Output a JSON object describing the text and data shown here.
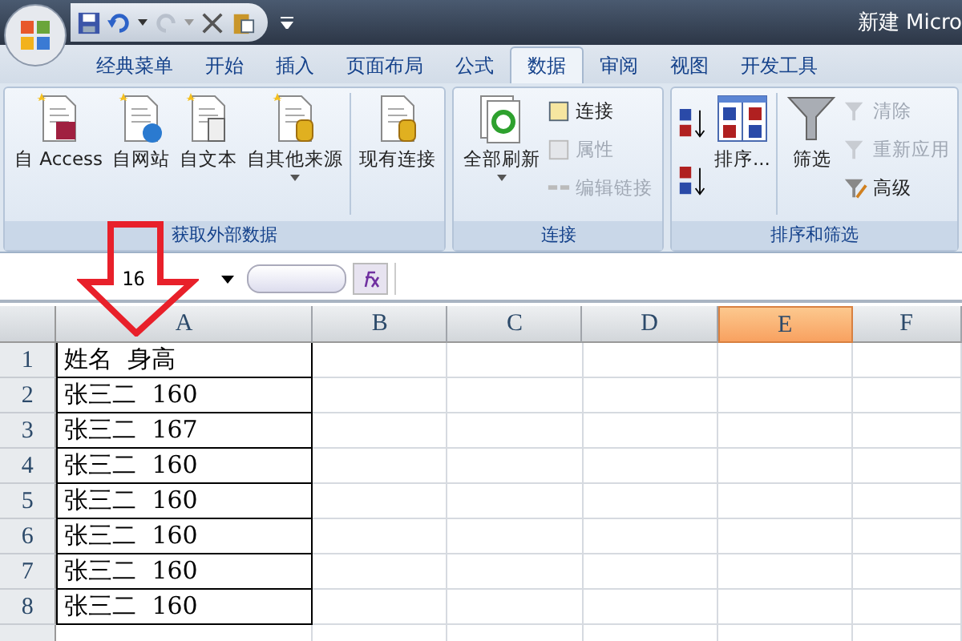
{
  "window": {
    "title": "新建 Micro"
  },
  "tabs": [
    {
      "label": "经典菜单",
      "selected": false
    },
    {
      "label": "开始",
      "selected": false
    },
    {
      "label": "插入",
      "selected": false
    },
    {
      "label": "页面布局",
      "selected": false
    },
    {
      "label": "公式",
      "selected": false
    },
    {
      "label": "数据",
      "selected": true
    },
    {
      "label": "审阅",
      "selected": false
    },
    {
      "label": "视图",
      "selected": false
    },
    {
      "label": "开发工具",
      "selected": false
    }
  ],
  "ribbon_groups": [
    {
      "label": "获取外部数据",
      "items": [
        {
          "kind": "large",
          "label": "自 Access",
          "disabled": false,
          "dropdown": false
        },
        {
          "kind": "large",
          "label": "自网站",
          "disabled": false,
          "dropdown": false
        },
        {
          "kind": "large",
          "label": "自文本",
          "disabled": false,
          "dropdown": false
        },
        {
          "kind": "large",
          "label": "自其他来源",
          "disabled": false,
          "dropdown": true
        },
        {
          "kind": "large",
          "label": "现有连接",
          "disabled": false,
          "dropdown": false
        }
      ]
    },
    {
      "label": "连接",
      "items": [
        {
          "kind": "large",
          "label": "全部刷新",
          "disabled": false,
          "dropdown": true
        },
        {
          "kind": "small",
          "label": "连接",
          "disabled": false
        },
        {
          "kind": "small",
          "label": "属性",
          "disabled": true
        },
        {
          "kind": "small",
          "label": "编辑链接",
          "disabled": true
        }
      ]
    },
    {
      "label": "排序和筛选",
      "items": [
        {
          "kind": "sortpair"
        },
        {
          "kind": "large",
          "label": "排序...",
          "disabled": false,
          "dropdown": false
        },
        {
          "kind": "large",
          "label": "筛选",
          "disabled": false,
          "dropdown": false
        },
        {
          "kind": "small",
          "label": "清除",
          "disabled": true
        },
        {
          "kind": "small",
          "label": "重新应用",
          "disabled": true
        },
        {
          "kind": "small",
          "label": "高级",
          "disabled": false
        }
      ]
    }
  ],
  "name_box": "16",
  "columns": [
    {
      "label": "A",
      "selected": false
    },
    {
      "label": "B",
      "selected": false
    },
    {
      "label": "C",
      "selected": false
    },
    {
      "label": "D",
      "selected": false
    },
    {
      "label": "E",
      "selected": true
    },
    {
      "label": "F",
      "selected": false
    }
  ],
  "rows": [
    {
      "number": "1",
      "cell_a": "姓名  身高"
    },
    {
      "number": "2",
      "cell_a": "张三二  160"
    },
    {
      "number": "3",
      "cell_a": "张三二  167"
    },
    {
      "number": "4",
      "cell_a": "张三二  160"
    },
    {
      "number": "5",
      "cell_a": "张三二  160"
    },
    {
      "number": "6",
      "cell_a": "张三二  160"
    },
    {
      "number": "7",
      "cell_a": "张三二  160"
    },
    {
      "number": "8",
      "cell_a": "张三二  160"
    }
  ]
}
